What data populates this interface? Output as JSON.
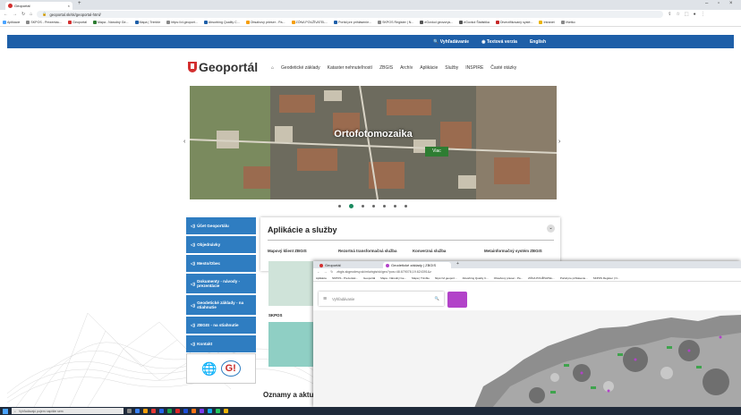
{
  "browser": {
    "tabs": [
      {
        "label": "Geoportál"
      }
    ],
    "address": "geoportal.sk/sk/geoportal-html/",
    "bookmarks": [
      "Aplikácie",
      "SKPOS - Prezentác...",
      "Geoportál",
      "Mapa - Národný Ge...",
      "Mapa | Trimble",
      "https://vl.geoport...",
      "Absorbing Quality C...",
      "Obsahový prieser - Pa...",
      "ZÓNA POUŽÍVATEL...",
      "Portál pre prihlásenie...",
      "SKPOS Register | N...",
      "eGovkol geovorys...",
      "eGovkol Štatistika",
      "Diverzifikovaný systé...",
      "Intranet",
      "Všetko"
    ]
  },
  "topbar": {
    "search": "Vyhľadávanie",
    "contrast": "Textová verzia",
    "language": "English"
  },
  "logo": {
    "text": "Geoportál"
  },
  "nav": [
    "Geodetické základy",
    "Kataster nehnuteľností",
    "ZBGIS",
    "Archív",
    "Aplikácie",
    "Služby",
    "INSPIRE",
    "Časté otázky"
  ],
  "hero": {
    "title": "Ortofotomozaika",
    "button": "Viac",
    "prev": "‹",
    "next": "›"
  },
  "left_menu": [
    "Účet Geoportálu",
    "Objednávky",
    "Mesto/Obec",
    "Dokumenty - návody - prezentácie",
    "Geodetické základy - na stiahnutie",
    "ZBGIS - na stiahnutie",
    "Kontakt"
  ],
  "apps": {
    "title": "Aplikácie a služby",
    "columns": [
      "Mapový klient ZBGIS",
      "Rezortná transformačná služba",
      "Konverzná služba",
      "Metainformačný systém ZBGIS"
    ],
    "skpos": "SKPOS"
  },
  "news_title": "Oznamy a aktu",
  "overlay": {
    "tabs": [
      "Geoportál",
      "Geodetické základy | ZBGIS"
    ],
    "address": "zbgis.skgeodesy.sk/mkzbgis/sk/geo?pos=48.679078,19.624391&z",
    "bookmarks": [
      "Aplikácie",
      "SKPOS - Prezentác...",
      "Geoportál",
      "Mapa - Národný Ge...",
      "Mapa | Trimble",
      "https://vl.geoport...",
      "Absorbing Quality C...",
      "Obsahový prieser - Pa...",
      "ZÓNA POUŽÍVATEL...",
      "Portál pre prihlásenie...",
      "SKPOS Register | N..."
    ],
    "search_placeholder": "Vyhľadávanie"
  },
  "taskbar": {
    "search_placeholder": "Vyhľadávajú pojem napíšte sem"
  }
}
